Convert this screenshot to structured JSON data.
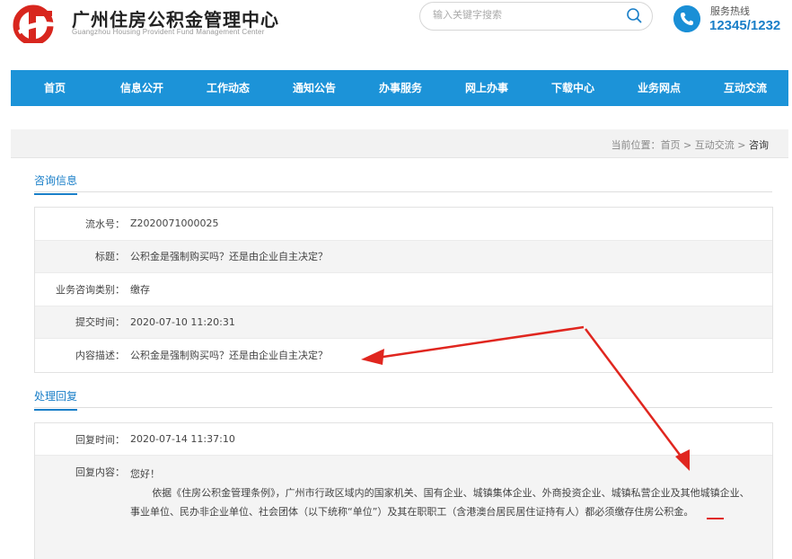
{
  "header": {
    "title": "广州住房公积金管理中心",
    "subtitle": "Guangzhou Housing Provident Fund Management Center",
    "search_placeholder": "输入关键字搜索",
    "hotline_label": "服务热线",
    "hotline_number": "12345/1232"
  },
  "nav": {
    "items": [
      "首页",
      "信息公开",
      "工作动态",
      "通知公告",
      "办事服务",
      "网上办事",
      "下载中心",
      "业务网点",
      "互动交流"
    ]
  },
  "breadcrumb": {
    "prefix": "当前位置：",
    "home": "首页",
    "sep1": " > ",
    "parent": "互动交流",
    "sep2": " > ",
    "current": "咨询"
  },
  "consult": {
    "section_title": "咨询信息",
    "rows": [
      {
        "label": "流水号：",
        "value": "Z2020071000025"
      },
      {
        "label": "标题：",
        "value": "公积金是强制购买吗？还是由企业自主决定？"
      },
      {
        "label": "业务咨询类别：",
        "value": "缴存"
      },
      {
        "label": "提交时间：",
        "value": "2020-07-10 11:20:31"
      },
      {
        "label": "内容描述：",
        "value": "公积金是强制购买吗？还是由企业自主决定？"
      }
    ]
  },
  "reply": {
    "section_title": "处理回复",
    "time_label": "回复时间：",
    "time_value": "2020-07-14 11:37:10",
    "content_label": "回复内容：",
    "greeting": "您好！",
    "paragraph": "依据《住房公积金管理条例》，广州市行政区域内的国家机关、国有企业、城镇集体企业、外商投资企业、城镇私营企业及其他城镇企业、事业单位、民办非企业单位、社会团体（以下统称“单位”）及其在职职工（含港澳台居民居住证持有人）都必须缴存住房公积金。"
  },
  "colors": {
    "nav_bg": "#1c93d8",
    "accent": "#1a7fc8",
    "arrow": "#e0261f"
  }
}
